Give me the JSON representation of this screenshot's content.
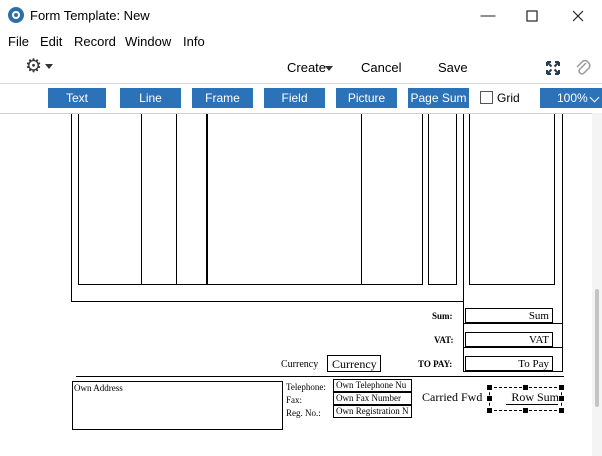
{
  "window": {
    "title": "Form Template: New"
  },
  "menu": {
    "file": "File",
    "edit": "Edit",
    "record": "Record",
    "window": "Window",
    "info": "Info"
  },
  "toolbar": {
    "create": "Create",
    "cancel": "Cancel",
    "save": "Save"
  },
  "palette": {
    "text": "Text",
    "line": "Line",
    "frame": "Frame",
    "field": "Field",
    "picture": "Picture",
    "page_sum": "Page Sum",
    "grid": "Grid",
    "grid_checked": false,
    "zoom": "100%"
  },
  "form": {
    "sum_label": "Sum:",
    "sum_field": "Sum",
    "vat_label": "VAT:",
    "vat_field": "VAT",
    "topay_label": "TO PAY:",
    "topay_field": "To Pay",
    "currency_label": "Currency",
    "currency_field": "Currency",
    "own_address": "Own Address",
    "telephone_label": "Telephone:",
    "telephone_field": "Own Telephone Nu",
    "fax_label": "Fax:",
    "fax_field": "Own Fax Number",
    "regno_label": "Reg. No.:",
    "regno_field": "Own Registration N",
    "carried_fwd": "Carried Fwd",
    "row_sum": "Row Sum"
  },
  "colors": {
    "accent": "#2b72b8",
    "background": "#ffffff"
  }
}
